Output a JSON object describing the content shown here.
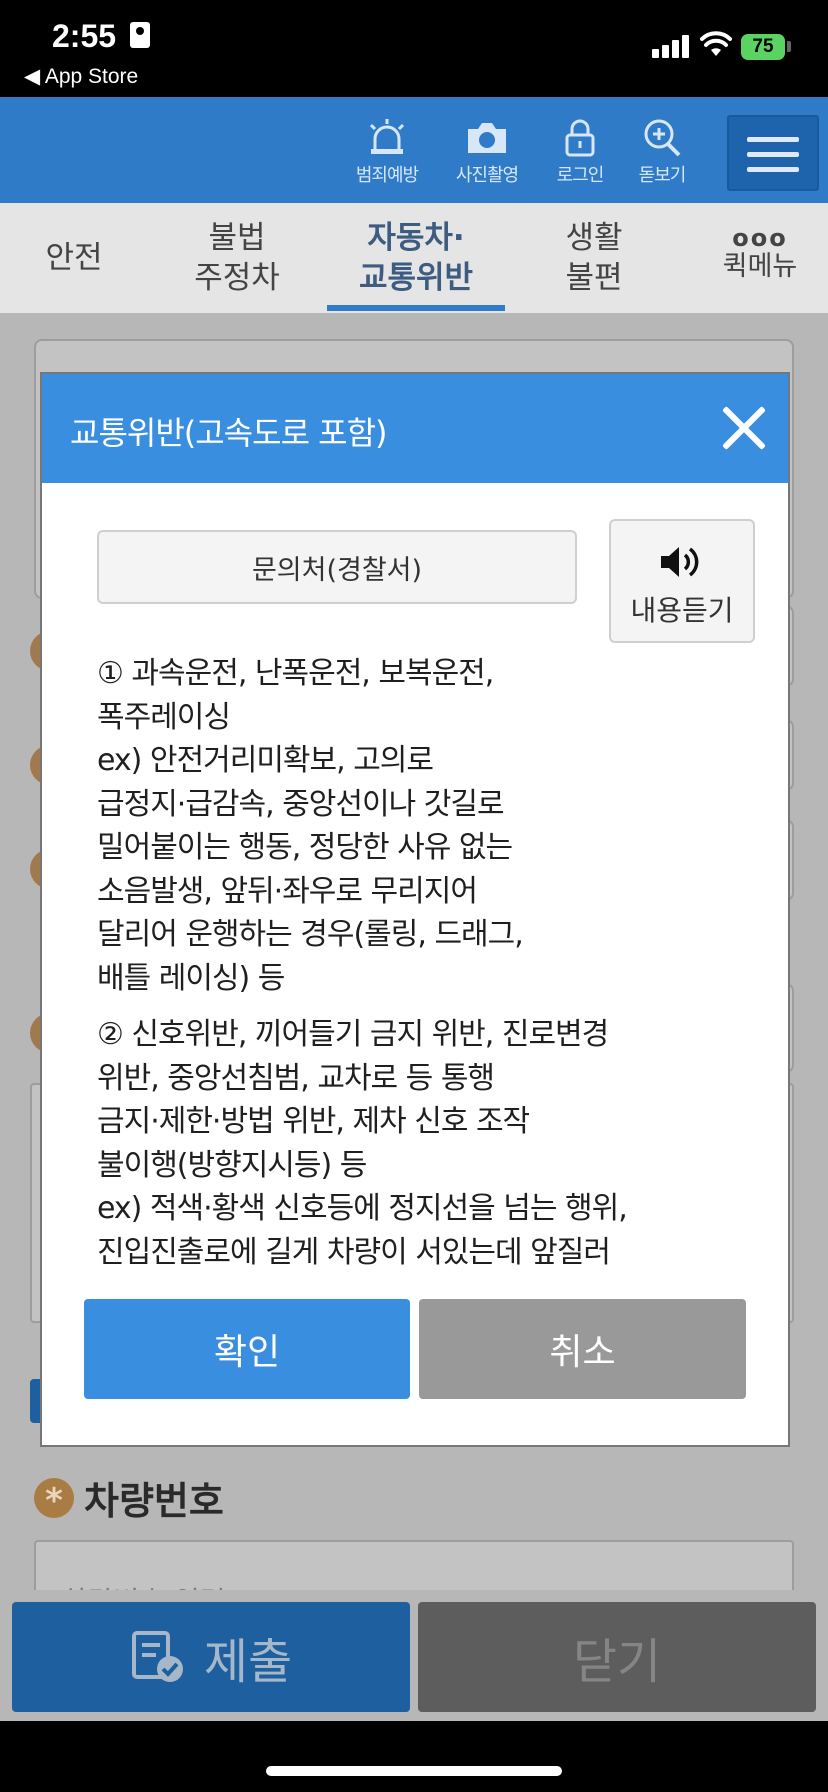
{
  "status_bar": {
    "time": "2:55",
    "back_label": "◀ App Store",
    "battery": "75"
  },
  "header": {
    "buttons": [
      {
        "label": "범죄예방",
        "icon": "siren-icon"
      },
      {
        "label": "사진촬영",
        "icon": "camera-icon"
      },
      {
        "label": "로그인",
        "icon": "lock-icon"
      },
      {
        "label": "돋보기",
        "icon": "zoom-icon"
      }
    ],
    "menu_icon": "hamburger-menu-icon"
  },
  "category_tabs": [
    {
      "line1": "안전",
      "line2": ""
    },
    {
      "line1": "불법",
      "line2": "주정차"
    },
    {
      "line1": "자동차·",
      "line2": "교통위반"
    },
    {
      "line1": "생활",
      "line2": "불편"
    },
    {
      "line1": "퀵메뉴",
      "line2": ""
    }
  ],
  "page": {
    "plate_label": "차량번호",
    "plate_placeholder": "차량번호 입력",
    "submit_label": "제출",
    "close_label": "닫기"
  },
  "modal": {
    "title": "교통위반(고속도로 포함)",
    "inquiry_label": "문의처(경찰서)",
    "listen_label": "내용듣기",
    "paragraphs": [
      [
        "① 과속운전, 난폭운전, 보복운전,",
        "폭주레이싱",
        "ex) 안전거리미확보, 고의로",
        "급정지·급감속, 중앙선이나 갓길로",
        "밀어붙이는 행동, 정당한 사유 없는",
        "소음발생, 앞뒤·좌우로 무리지어",
        "달리어 운행하는 경우(롤링, 드래그,",
        "배틀 레이싱) 등"
      ],
      [
        "② 신호위반, 끼어들기 금지 위반, 진로변경",
        "위반, 중앙선침범, 교차로 등 통행",
        "금지·제한·방법 위반, 제차 신호 조작",
        "불이행(방향지시등) 등",
        "ex) 적색·황색 신호등에 정지선을 넘는 행위,",
        "진입진출로에 길게 차량이 서있는데 앞질러"
      ]
    ],
    "confirm_label": "확인",
    "cancel_label": "취소"
  },
  "colors": {
    "header_blue": "#2f7bc8",
    "modal_blue": "#3a8ee0",
    "cancel_gray": "#999999"
  }
}
